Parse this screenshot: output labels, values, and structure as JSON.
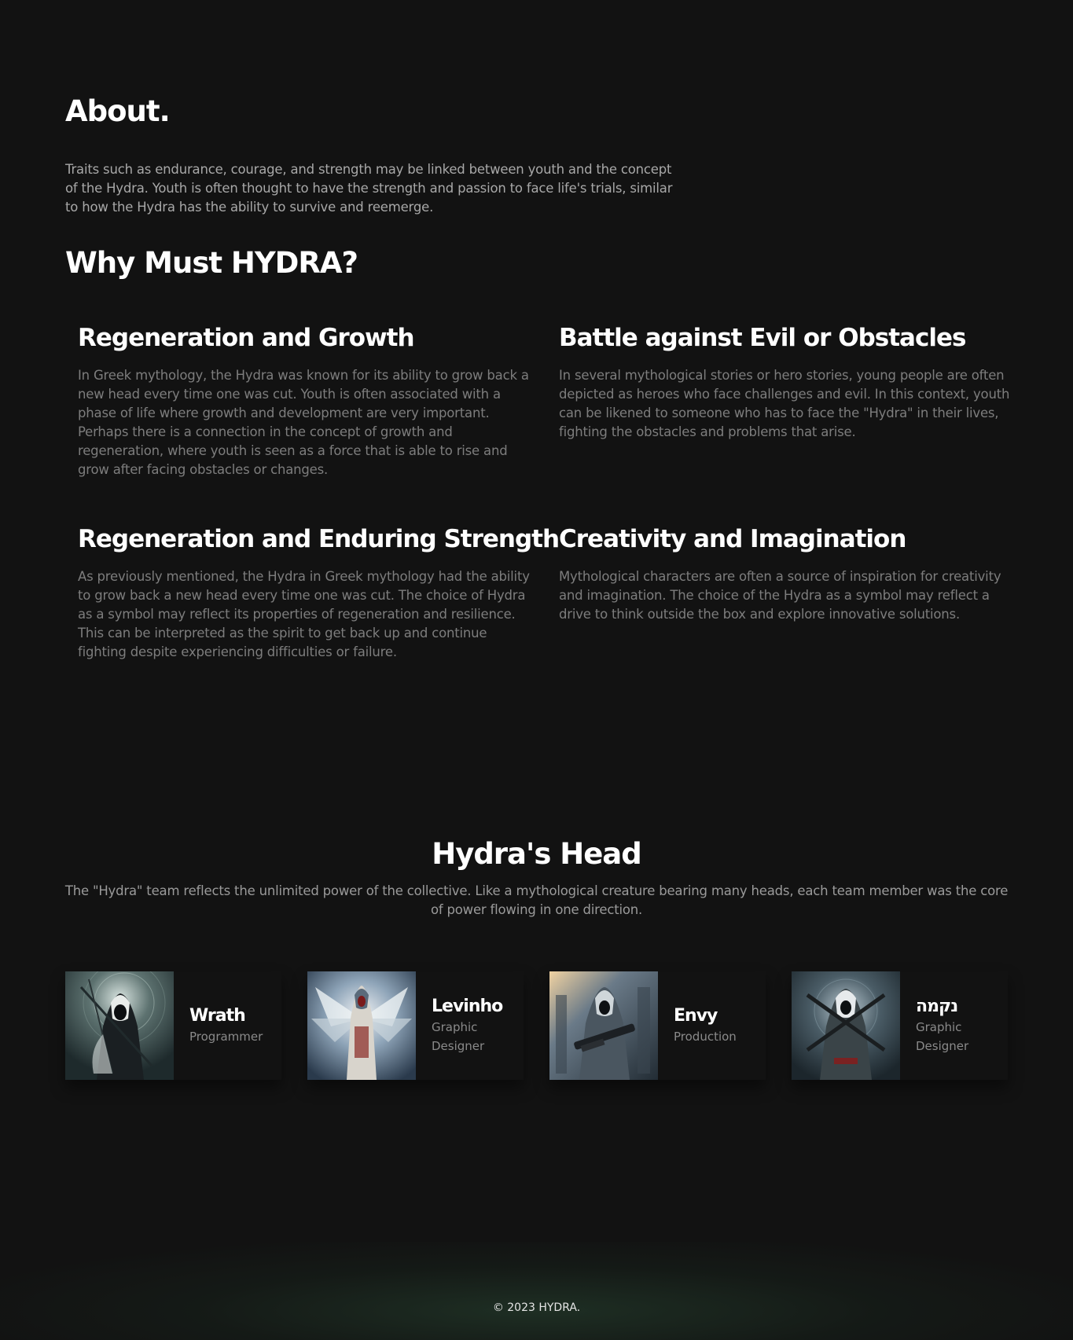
{
  "about": {
    "title": "About.",
    "text": "Traits such as endurance, courage, and strength may be linked between youth and the concept of the Hydra. Youth is often thought to have the strength and passion to face life's trials, similar to how the Hydra has the ability to survive and reemerge."
  },
  "why": {
    "title": "Why Must HYDRA?",
    "features": [
      {
        "title": "Regeneration and Growth",
        "text": "In Greek mythology, the Hydra was known for its ability to grow back a new head every time one was cut. Youth is often associated with a phase of life where growth and development are very important. Perhaps there is a connection in the concept of growth and regeneration, where youth is seen as a force that is able to rise and grow after facing obstacles or changes."
      },
      {
        "title": "Battle against Evil or Obstacles",
        "text": "In several mythological stories or hero stories, young people are often depicted as heroes who face challenges and evil. In this context, youth can be likened to someone who has to face the \"Hydra\" in their lives, fighting the obstacles and problems that arise."
      },
      {
        "title": "Regeneration and Enduring Strength",
        "text": "As previously mentioned, the Hydra in Greek mythology had the ability to grow back a new head every time one was cut. The choice of Hydra as a symbol may reflect its properties of regeneration and resilience. This can be interpreted as the spirit to get back up and continue fighting despite experiencing difficulties or failure."
      },
      {
        "title": "Creativity and Imagination",
        "text": "Mythological characters are often a source of inspiration for creativity and imagination. The choice of the Hydra as a symbol may reflect a drive to think outside the box and explore innovative solutions."
      }
    ]
  },
  "team": {
    "title": "Hydra's Head",
    "description": "The \"Hydra\" team reflects the unlimited power of the collective. Like a mythological creature bearing many heads, each team member was the core of power flowing in one direction.",
    "members": [
      {
        "name": "Wrath",
        "role": "Programmer",
        "avatar_bg": "#2c3a3c"
      },
      {
        "name": "Levinho",
        "role": "Graphic Designer",
        "avatar_bg": "#3a4a5a"
      },
      {
        "name": "Envy",
        "role": "Production",
        "avatar_bg": "#34404a"
      },
      {
        "name": "נקמה",
        "role": "Graphic Designer",
        "avatar_bg": "#2e3c44"
      }
    ]
  },
  "footer": {
    "text": "© 2023 HYDRA."
  }
}
